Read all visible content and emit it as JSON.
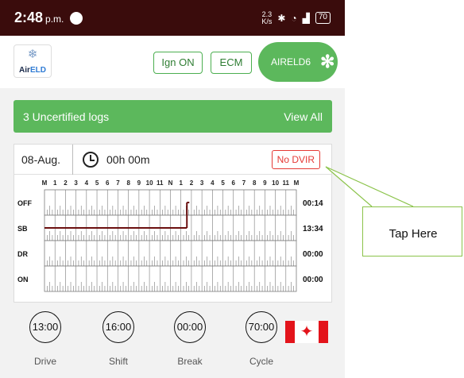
{
  "status_bar": {
    "time": "2:48",
    "ampm": "p.m.",
    "speed_value": "2.3",
    "speed_unit": "K/s",
    "battery": "70",
    "icons": [
      "notification-icon",
      "bluetooth-icon",
      "wifi-icon",
      "signal-icon",
      "battery-icon"
    ]
  },
  "header": {
    "logo_air": "Air",
    "logo_eld": "ELD",
    "ign_label": "Ign ON",
    "ecm_label": "ECM",
    "device_label": "AIRELD6"
  },
  "banner": {
    "text": "3 Uncertified logs",
    "action": "View All"
  },
  "log": {
    "date": "08-Aug.",
    "duration": "00h 00m",
    "dvir_label": "No DVIR"
  },
  "chart_data": {
    "type": "line",
    "hour_labels": [
      "M",
      "1",
      "2",
      "3",
      "4",
      "5",
      "6",
      "7",
      "8",
      "9",
      "10",
      "11",
      "N",
      "1",
      "2",
      "3",
      "4",
      "5",
      "6",
      "7",
      "8",
      "9",
      "10",
      "11",
      "M"
    ],
    "rows": [
      {
        "label": "OFF",
        "total": "00:14"
      },
      {
        "label": "SB",
        "total": "13:34"
      },
      {
        "label": "DR",
        "total": "00:00"
      },
      {
        "label": "ON",
        "total": "00:00"
      }
    ],
    "segments": [
      {
        "status": "SB",
        "start_hour": 0,
        "end_hour": 13.57
      },
      {
        "status": "OFF",
        "start_hour": 13.57,
        "end_hour": 13.8
      }
    ],
    "colors": {
      "line": "#6b0f0f",
      "grid": "#7a7a7a"
    }
  },
  "timers": [
    {
      "value": "13:00",
      "label": "Drive"
    },
    {
      "value": "16:00",
      "label": "Shift"
    },
    {
      "value": "00:00",
      "label": "Break"
    },
    {
      "value": "70:00",
      "label": "Cycle"
    }
  ],
  "callout": {
    "text": "Tap Here"
  },
  "colors": {
    "status_bar": "#3a0c0c",
    "accent_green": "#5cb85c",
    "dvir_red": "#e53935"
  }
}
